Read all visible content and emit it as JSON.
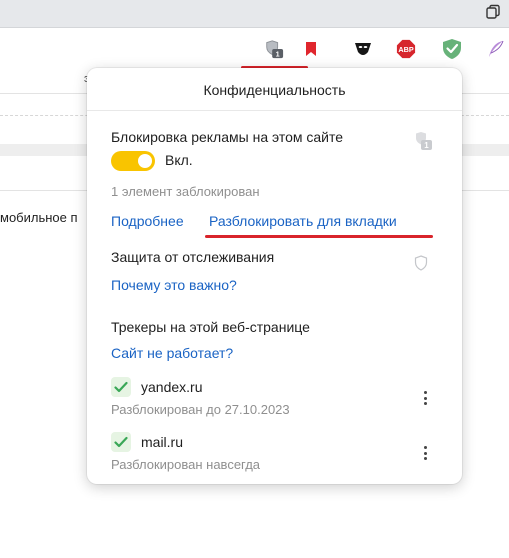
{
  "popup": {
    "title": "Конфиденциальность",
    "adblock": {
      "title": "Блокировка рекламы на этом сайте",
      "badge_count": "1",
      "toggle_label": "Вкл.",
      "toggle_on": true,
      "blocked_count_text": "1 элемент заблокирован",
      "details_link": "Подробнее",
      "unblock_link": "Разблокировать для вкладки"
    },
    "tracking": {
      "title": "Защита от отслеживания",
      "why_link": "Почему это важно?"
    },
    "trackers": {
      "title": "Трекеры на этой веб-странице",
      "site_broken_link": "Сайт не работает?",
      "items": [
        {
          "name": "yandex.ru",
          "status": "Разблокирован до 27.10.2023"
        },
        {
          "name": "mail.ru",
          "status": "Разблокирован навсегда"
        }
      ]
    }
  },
  "toolbar": {
    "privacy_badge_count": "1",
    "extensions": [
      "privacy-shield-icon",
      "bookmark-icon",
      "ninja-icon",
      "abp-icon",
      "adguard-icon",
      "quill-icon"
    ],
    "abp_label": "ABP"
  },
  "background": {
    "page_text": "мобильное п"
  },
  "colors": {
    "accent_link": "#1a63c4",
    "toggle_on": "#f9c400",
    "highlight_red": "#d9242b",
    "check_green": "#3aa757"
  }
}
